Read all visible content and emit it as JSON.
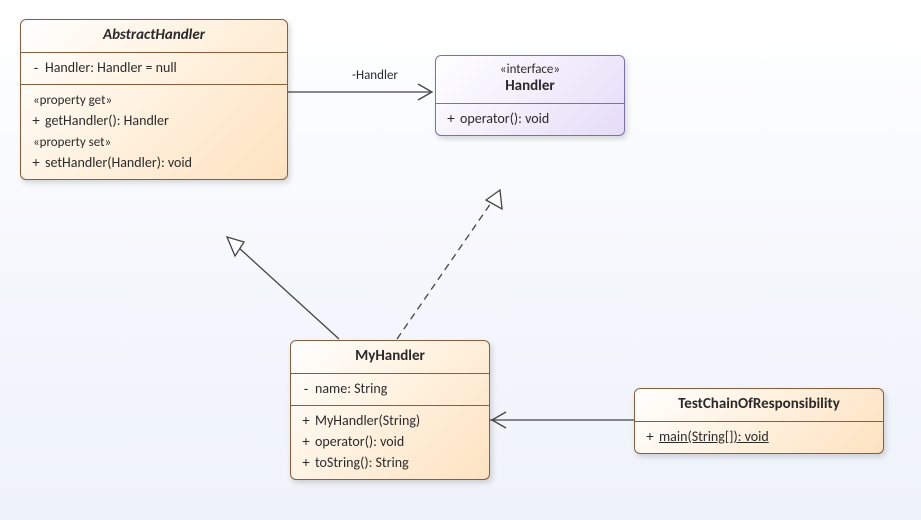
{
  "diagram": {
    "classes": {
      "abstractHandler": {
        "name": "AbstractHandler",
        "abstract": true,
        "attributes": [
          {
            "visibility": "-",
            "signature": "Handler: Handler = null"
          }
        ],
        "propGetLabel": "«property get»",
        "propGet": [
          {
            "visibility": "+",
            "signature": "getHandler(): Handler"
          }
        ],
        "propSetLabel": "«property set»",
        "propSet": [
          {
            "visibility": "+",
            "signature": "setHandler(Handler): void"
          }
        ]
      },
      "handler": {
        "stereotype": "«interface»",
        "name": "Handler",
        "operations": [
          {
            "visibility": "+",
            "signature": "operator(): void"
          }
        ]
      },
      "myHandler": {
        "name": "MyHandler",
        "attributes": [
          {
            "visibility": "-",
            "signature": "name: String"
          }
        ],
        "operations": [
          {
            "visibility": "+",
            "signature": "MyHandler(String)"
          },
          {
            "visibility": "+",
            "signature": "operator(): void"
          },
          {
            "visibility": "+",
            "signature": "toString(): String"
          }
        ]
      },
      "testCoR": {
        "name": "TestChainOfResponsibility",
        "operations": [
          {
            "visibility": "+",
            "signature": "main(String[]): void",
            "static": true
          }
        ]
      }
    },
    "edgeLabel": "-Handler"
  },
  "colors": {
    "classBorder": "#8a5d3b",
    "interfaceBorder": "#7d6fae"
  }
}
